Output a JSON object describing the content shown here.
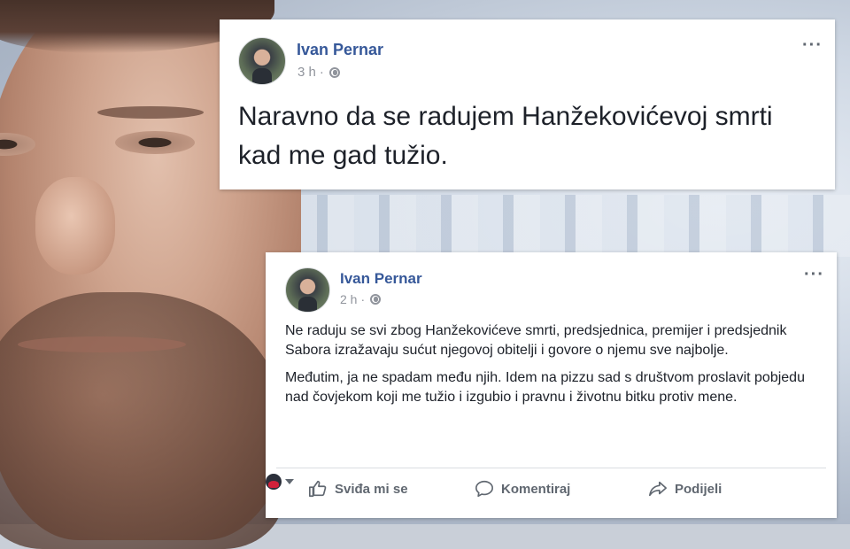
{
  "post_top": {
    "author": "Ivan Pernar",
    "time": "3 h",
    "separator": "·",
    "text_line1": "Naravno da se radujem Hanžekovićevoj smrti",
    "text_line2": "kad me gad tužio."
  },
  "post_bottom": {
    "author": "Ivan Pernar",
    "time": "2 h",
    "separator": "·",
    "paragraph1": "Ne raduju se svi zbog Hanžekovićeve smrti, predsjednica, premijer i predsjednik Sabora izražavaju sućut njegovoj obitelji i govore o njemu sve najbolje.",
    "paragraph2": "Međutim, ja ne spadam među njih. Idem na pizzu sad s društvom proslavit pobjedu nad čovjekom koji me tužio i izgubio i pravnu i životnu bitku protiv mene.",
    "actions": {
      "like": "Sviđa mi se",
      "comment": "Komentiraj",
      "share": "Podijeli"
    }
  },
  "colors": {
    "author": "#365899",
    "meta": "#90949c",
    "text": "#1d2129",
    "action": "#606770"
  }
}
